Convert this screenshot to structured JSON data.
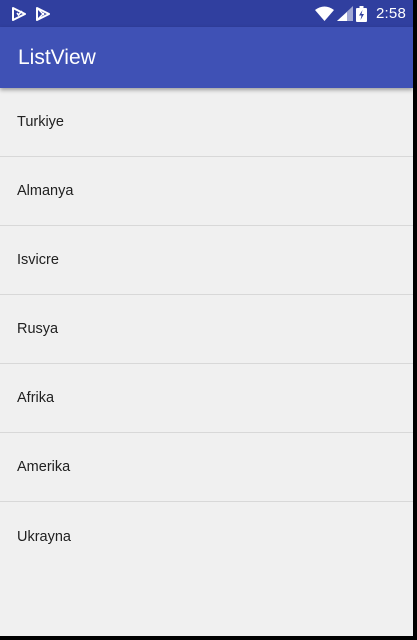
{
  "status_bar": {
    "time": "2:58",
    "left_icons": [
      "play-protect-icon",
      "play-store-icon"
    ],
    "right_icons": [
      "wifi-icon",
      "cell-signal-icon",
      "battery-charging-icon"
    ]
  },
  "app_bar": {
    "title": "ListView",
    "color": "#3f51b5"
  },
  "list": {
    "items": [
      {
        "label": "Turkiye"
      },
      {
        "label": "Almanya"
      },
      {
        "label": "Isvicre"
      },
      {
        "label": "Rusya"
      },
      {
        "label": "Afrika"
      },
      {
        "label": "Amerika"
      },
      {
        "label": "Ukrayna"
      }
    ]
  }
}
